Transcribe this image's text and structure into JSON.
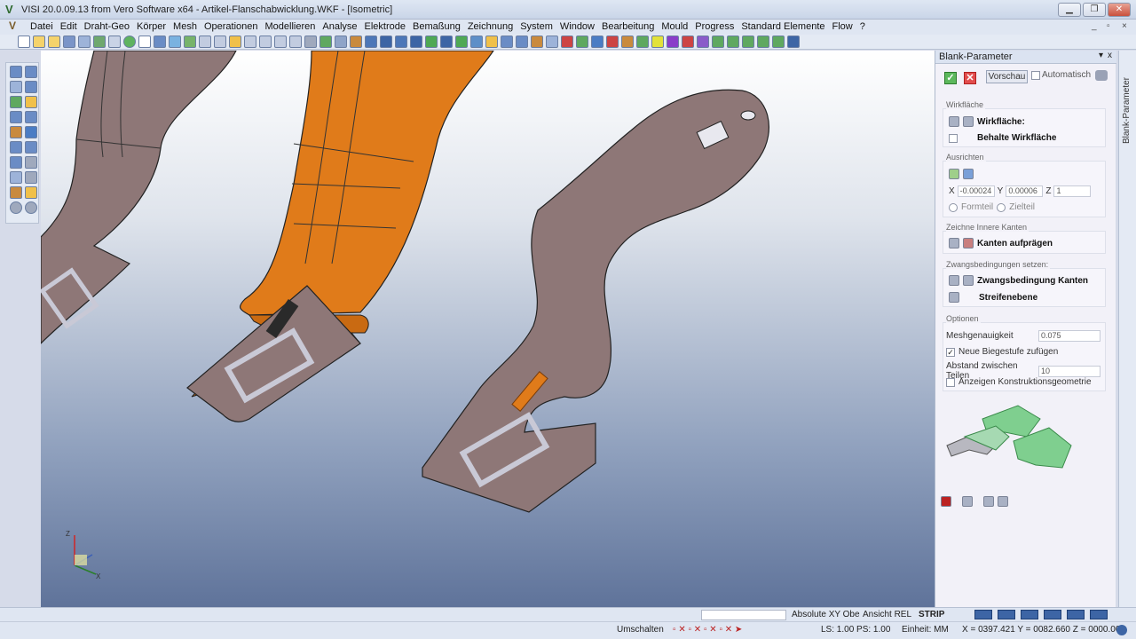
{
  "window": {
    "title": "VISI 20.0.09.13 from Vero Software x64 - Artikel-Flanschabwicklung.WKF - [Isometric]",
    "app_icon": "V",
    "controls": [
      "minimize-icon",
      "restore-icon",
      "close-icon"
    ],
    "control_glyphs": [
      "▁",
      "❐",
      "✕"
    ],
    "mdi_controls": [
      "_",
      "▫",
      "×"
    ]
  },
  "menu": {
    "logo": "V",
    "items": [
      "Datei",
      "Edit",
      "Draht-Geo",
      "Körper",
      "Mesh",
      "Operationen",
      "Modellieren",
      "Analyse",
      "Elektrode",
      "Bemaßung",
      "Zeichnung",
      "System",
      "Window",
      "Bearbeitung",
      "Mould",
      "Progress",
      "Standard Elemente",
      "Flow",
      "?"
    ]
  },
  "panel": {
    "header": "Blank-Parameter",
    "pin_glyph": "▾",
    "close_glyph": "x",
    "vertical_tab": "Blank-Parameter",
    "ok_glyph": "✓",
    "cancel_glyph": "✕",
    "vorschau": "Vorschau",
    "automatisch": "Automatisch",
    "sections": {
      "wirkflaeche": {
        "label": "Wirkfläche",
        "wirkflaeche": "Wirkfläche:",
        "behalte": "Behalte Wirkfläche"
      },
      "ausrichten": {
        "label": "Ausrichten",
        "x_label": "X",
        "x_value": "-0.00024",
        "y_label": "Y",
        "y_value": "0.00006",
        "z_label": "Z",
        "z_value": "1",
        "radio1": "Formteil",
        "radio2": "Zielteil"
      },
      "innere": {
        "label": "Zeichne Innere Kanten",
        "kanten": "Kanten aufprägen"
      },
      "zwang": {
        "label": "Zwangsbedingungen setzen:",
        "item1": "Zwangsbedingung Kanten",
        "item2": "Streifenebene"
      },
      "optionen": {
        "label": "Optionen",
        "mesh_label": "Meshgenauigkeit",
        "mesh_value": "0.075",
        "neue_biege": "Neue Biegestufe zufügen",
        "neue_biege_checked": true,
        "abstand_label": "Abstand zwischen Teilen",
        "abstand_value": "10",
        "anzeigen": "Anzeigen Konstruktionsgeometrie",
        "anzeigen_checked": false
      }
    }
  },
  "status": {
    "absolute": "Absolute XY Obe",
    "ansicht": "Ansicht REL",
    "strip": "STRIP",
    "umschalten": "Umschalten",
    "ls": "LS: 1.00 PS: 1.00",
    "einheit": "Einheit: MM",
    "coords": "X = 0397.421 Y = 0082.660 Z = 0000.000"
  },
  "axis": {
    "z": "Z",
    "x": "X"
  },
  "colors": {
    "part": "#8e7777",
    "part_edge": "#222",
    "highlight": "#e07b1a",
    "viewport_bottom": "#5f739a",
    "status_box": "#3d65a5"
  }
}
